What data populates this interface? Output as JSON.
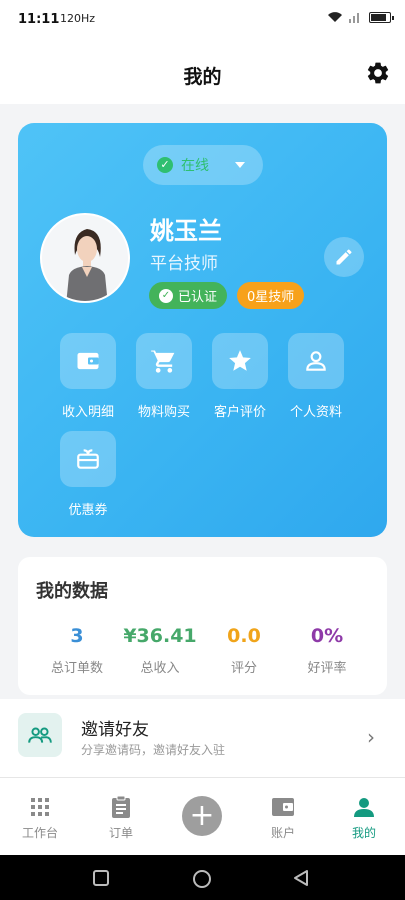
{
  "status_bar": {
    "time": "11:11",
    "indicator": "120",
    "indicator_unit": "Hz"
  },
  "header": {
    "title": "我的"
  },
  "profile": {
    "status": "在线",
    "name": "姚玉兰",
    "role": "平台技师",
    "verified": "已认证",
    "level": "0星技师"
  },
  "actions": [
    {
      "label": "收入明细",
      "icon": "wallet-icon"
    },
    {
      "label": "物料购买",
      "icon": "cart-icon"
    },
    {
      "label": "客户评价",
      "icon": "star-icon"
    },
    {
      "label": "个人资料",
      "icon": "person-icon"
    },
    {
      "label": "优惠券",
      "icon": "gift-icon"
    }
  ],
  "my_data": {
    "title": "我的数据",
    "stats": [
      {
        "value": "3",
        "label": "总订单数",
        "color": "#3a8fd6"
      },
      {
        "value": "¥36.41",
        "label": "总收入",
        "color": "#46a86a"
      },
      {
        "value": "0.0",
        "label": "评分",
        "color": "#f0a41a"
      },
      {
        "value": "0%",
        "label": "好评率",
        "color": "#8e3aa8"
      }
    ]
  },
  "invite": {
    "title": "邀请好友",
    "subtitle": "分享邀请码，邀请好友入驻"
  },
  "tabs": [
    {
      "label": "工作台",
      "icon": "grid-icon"
    },
    {
      "label": "订单",
      "icon": "clipboard-icon"
    },
    {
      "label": "",
      "icon": "plus-icon"
    },
    {
      "label": "账户",
      "icon": "wallet-icon"
    },
    {
      "label": "我的",
      "icon": "person-icon",
      "active": true
    }
  ],
  "colors": {
    "accent": "#149a80",
    "card_blue": "#3ab4f2",
    "online_green": "#2fbf71",
    "level_orange": "#f7a11a"
  }
}
